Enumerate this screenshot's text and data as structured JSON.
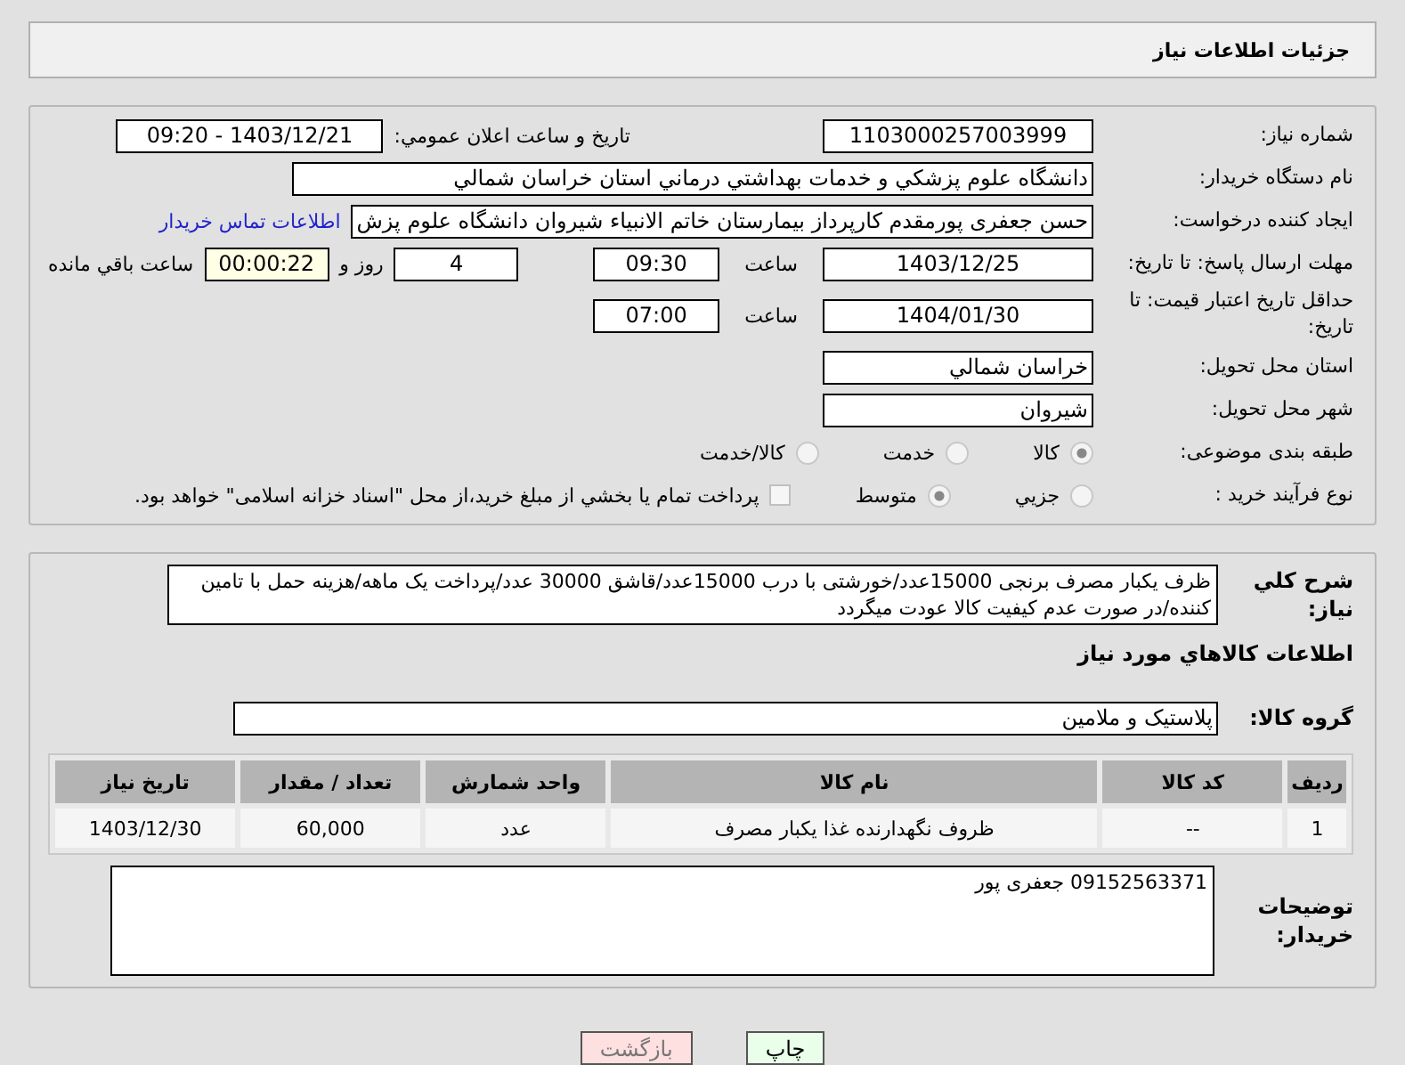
{
  "header": {
    "title": "جزئیات اطلاعات نیاز"
  },
  "need_number": {
    "label": "شماره نیاز:",
    "value": "1103000257003999"
  },
  "announce": {
    "label": "تاریخ و ساعت اعلان عمومي:",
    "value": "1403/12/21 - 09:20"
  },
  "buyer_org": {
    "label": "نام دستگاه خريدار:",
    "value": "دانشگاه علوم پزشکي و خدمات بهداشتي درماني استان خراسان شمالي"
  },
  "requester": {
    "label": "ايجاد کننده درخواست:",
    "value": "حسن جعفری پورمقدم کارپرداز بیمارستان خاتم الانبیاء شیروان دانشگاه علوم پزش",
    "link": "اطلاعات تماس خريدار"
  },
  "reply_deadline": {
    "label": "مهلت ارسال پاسخ: تا تاريخ:",
    "date": "1403/12/25",
    "time_label": "ساعت",
    "time": "09:30",
    "days": "4",
    "days_label": "روز و",
    "countdown": "00:00:22",
    "remaining_label": "ساعت باقي مانده"
  },
  "price_validity": {
    "label": "حداقل تاريخ اعتبار قيمت: تا تاريخ:",
    "date": "1404/01/30",
    "time_label": "ساعت",
    "time": "07:00"
  },
  "province": {
    "label": "استان محل تحويل:",
    "value": "خراسان شمالي"
  },
  "city": {
    "label": "شهر محل تحويل:",
    "value": "شيروان"
  },
  "category": {
    "label": "طبقه بندی موضوعی:",
    "options": [
      {
        "label": "کالا",
        "selected": true
      },
      {
        "label": "خدمت",
        "selected": false
      },
      {
        "label": "کالا/خدمت",
        "selected": false
      }
    ]
  },
  "purchase_type": {
    "label": "نوع فرآيند خريد :",
    "options": [
      {
        "label": "جزيي",
        "selected": false
      },
      {
        "label": "متوسط",
        "selected": true
      }
    ],
    "payment": {
      "label": "پرداخت تمام يا بخشي از مبلغ خريد،از محل \"اسناد خزانه اسلامی\" خواهد بود.",
      "checked": false
    }
  },
  "description": {
    "label": "شرح کلي نياز:",
    "value": "ظرف  یکبار مصرف برنجی 15000عدد/خورشتی با درب 15000عدد/قاشق 30000 عدد/پرداخت یک ماهه/هزینه حمل با تامین کننده/در صورت عدم کیفیت کالا عودت میگردد"
  },
  "goods_heading": "اطلاعات کالاهاي مورد نياز",
  "goods_group": {
    "label": "گروه کالا:",
    "value": "پلاستيک و ملامين"
  },
  "table": {
    "columns": [
      "رديف",
      "کد کالا",
      "نام کالا",
      "واحد شمارش",
      "تعداد / مقدار",
      "تاريخ نياز"
    ],
    "rows": [
      [
        "1",
        "--",
        "ظروف نگهدارنده غذا یکبار مصرف",
        "عدد",
        "60,000",
        "1403/12/30"
      ]
    ]
  },
  "buyer_notes": {
    "label": "توضيحات خريدار:",
    "value": "09152563371 جعفری پور"
  },
  "buttons": [
    {
      "label": "چاپ",
      "kind": "print"
    },
    {
      "label": "بازگشت",
      "kind": "back"
    }
  ]
}
